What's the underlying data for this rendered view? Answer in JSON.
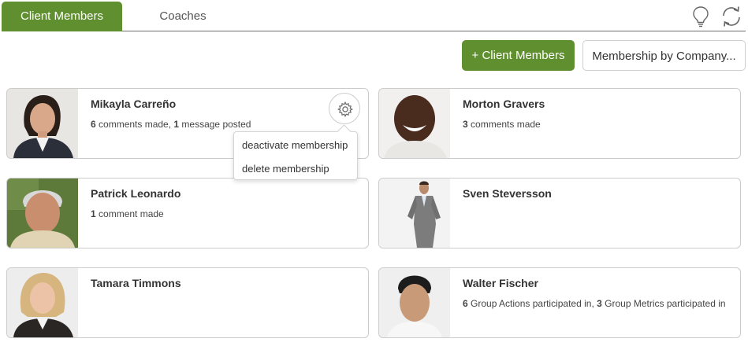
{
  "tabs": [
    {
      "label": "Client Members",
      "active": true
    },
    {
      "label": "Coaches",
      "active": false
    }
  ],
  "icons": {
    "lightbulb": "lightbulb-icon",
    "refresh": "refresh-icon",
    "gear": "gear-icon"
  },
  "actions": {
    "add_client_members": "+ Client Members",
    "membership_by_company": "Membership by Company..."
  },
  "colors": {
    "accent": "#5f8f2f",
    "border": "#cccccc"
  },
  "members": [
    {
      "name": "Mikayla Carreño",
      "stats": [
        {
          "count": "6",
          "text": " comments made, "
        },
        {
          "count": "1",
          "text": " message posted"
        }
      ]
    },
    {
      "name": "Morton Gravers",
      "stats": [
        {
          "count": "3",
          "text": " comments made"
        }
      ]
    },
    {
      "name": "Patrick Leonardo",
      "stats": [
        {
          "count": "1",
          "text": " comment made"
        }
      ]
    },
    {
      "name": "Sven Steversson",
      "stats": []
    },
    {
      "name": "Tamara Timmons",
      "stats": []
    },
    {
      "name": "Walter Fischer",
      "stats": [
        {
          "count": "6",
          "text": " Group Actions participated in, "
        },
        {
          "count": "3",
          "text": " Group Metrics participated in"
        }
      ]
    }
  ],
  "context_menu": {
    "items": [
      "deactivate membership",
      "delete membership"
    ]
  }
}
